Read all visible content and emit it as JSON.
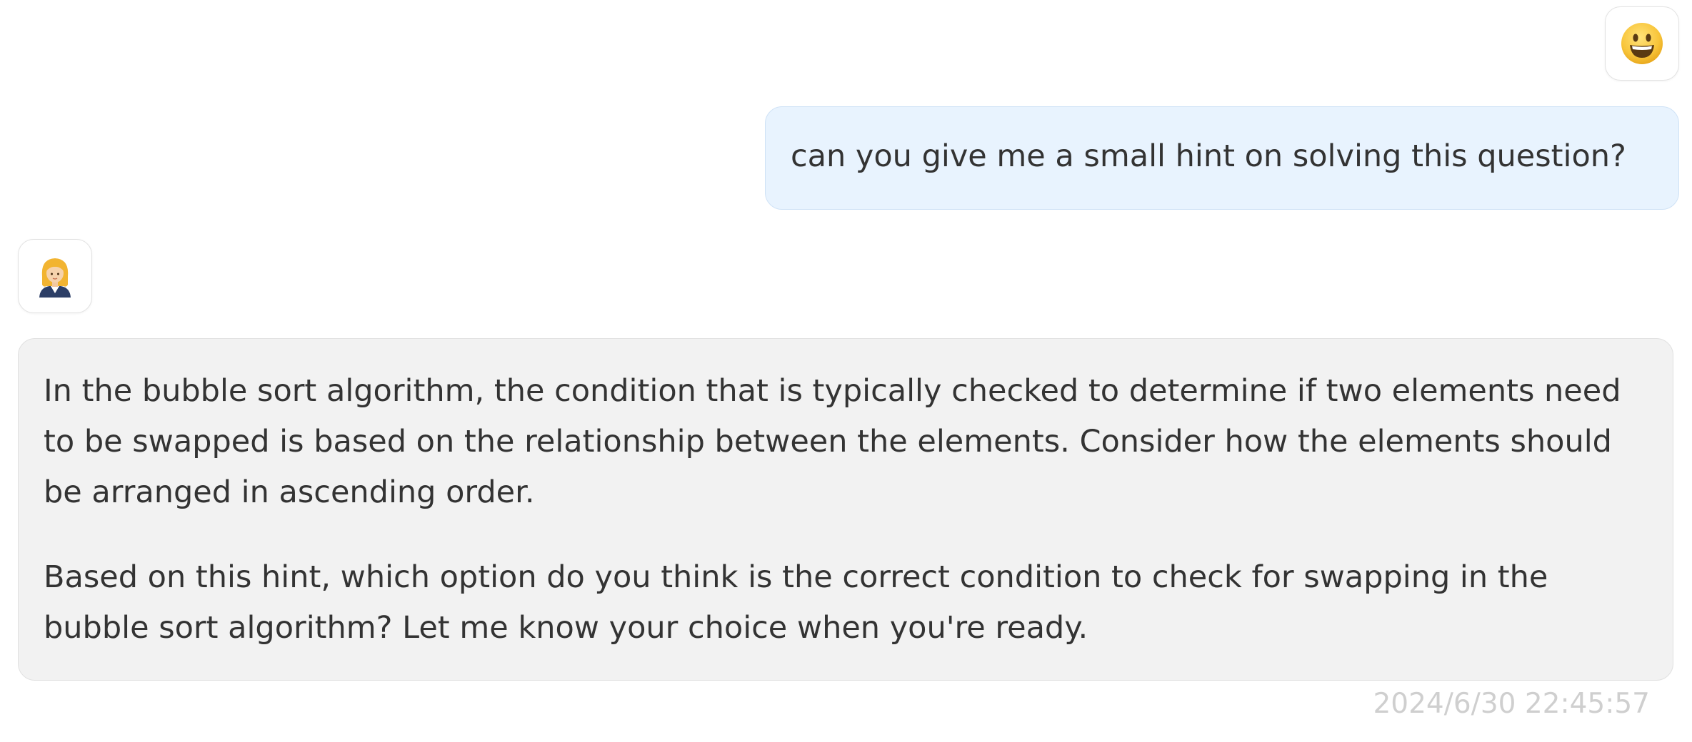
{
  "conversation": {
    "user_message": {
      "avatar_icon": "smiley-face-icon",
      "text": "can you give me a small hint on solving this question?",
      "bubble_color": "#e8f3fe"
    },
    "assistant_message": {
      "avatar_icon": "woman-office-worker-icon",
      "paragraphs": [
        "In the bubble sort algorithm, the condition that is typically checked to determine if two elements need to be swapped is based on the relationship between the elements. Consider how the elements should be arranged in ascending order.",
        "Based on this hint, which option do you think is the correct condition to check for swapping in the bubble sort algorithm? Let me know your choice when you're ready."
      ],
      "bubble_color": "#f2f2f2",
      "timestamp": "2024/6/30 22:45:57"
    }
  }
}
